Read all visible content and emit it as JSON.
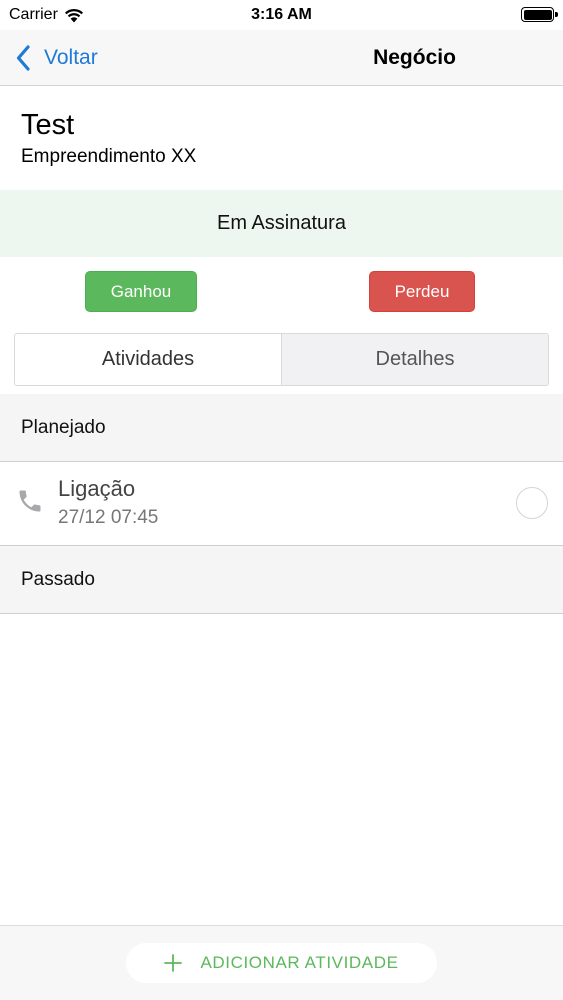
{
  "status_bar": {
    "carrier": "Carrier",
    "time": "3:16 AM"
  },
  "nav": {
    "back_label": "Voltar",
    "title": "Negócio"
  },
  "deal": {
    "title": "Test",
    "subtitle": "Empreendimento XX"
  },
  "stage": {
    "label": "Em Assinatura"
  },
  "actions": {
    "won_label": "Ganhou",
    "lost_label": "Perdeu"
  },
  "tabs": [
    {
      "label": "Atividades",
      "selected": true
    },
    {
      "label": "Detalhes",
      "selected": false
    }
  ],
  "sections": {
    "planned": {
      "title": "Planejado",
      "activities": [
        {
          "icon": "phone-icon",
          "name": "Ligação",
          "datetime": "27/12 07:45",
          "done": false
        }
      ]
    },
    "past": {
      "title": "Passado"
    }
  },
  "footer": {
    "add_icon": "plus-icon",
    "add_label": "ADICIONAR ATIVIDADE"
  },
  "colors": {
    "accent_blue": "#1e7ad6",
    "won_green": "#5cb85c",
    "lost_red": "#d9534f",
    "stage_background": "#eef7ef"
  }
}
